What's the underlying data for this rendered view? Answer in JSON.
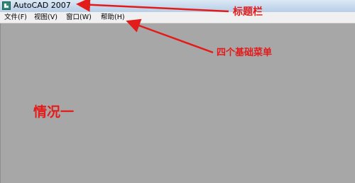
{
  "window": {
    "title": "AutoCAD 2007",
    "icon": "autocad-app-icon"
  },
  "menubar": {
    "items": [
      {
        "label": "文件(F)"
      },
      {
        "label": "视图(V)"
      },
      {
        "label": "窗口(W)"
      },
      {
        "label": "帮助(H)"
      }
    ]
  },
  "annotations": {
    "title_bar": "标题栏",
    "menus": "四个基础菜单",
    "case": "情况一",
    "color": "#e31b1b"
  },
  "colors": {
    "workspace": "#a7a7a7",
    "menubar": "#f0f0f0",
    "titlebar": "#c5d8ec"
  }
}
